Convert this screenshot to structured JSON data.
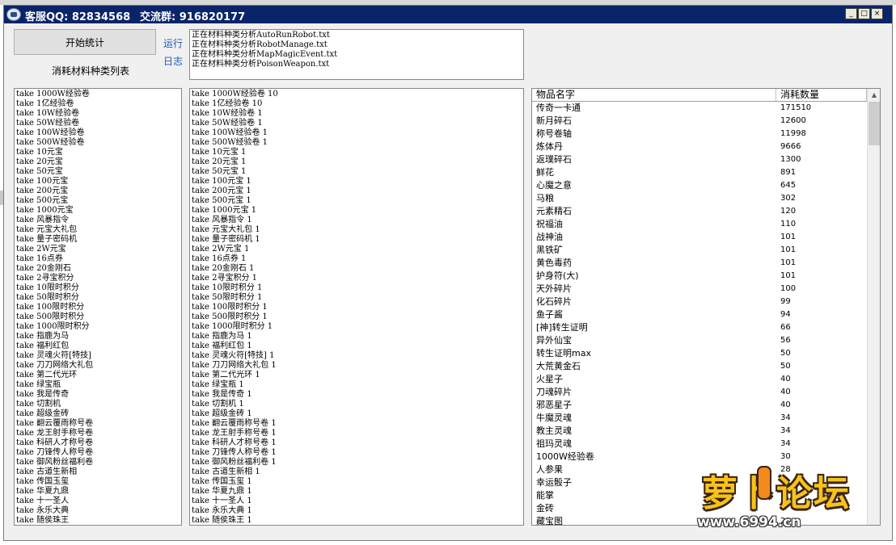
{
  "window": {
    "title_qq": "客服QQ: 82834568",
    "title_group": "交流群: 916820177",
    "minimize_glyph": "_",
    "maximize_glyph": "□",
    "close_glyph": "×"
  },
  "controls": {
    "start_button": "开始统计",
    "list_caption": "消耗材料种类列表",
    "run_link": "运行",
    "log_link": "日志"
  },
  "log_lines": [
    "正在材料种类分析AutoRunRobot.txt",
    "正在材料种类分析RobotManage.txt",
    "正在材料种类分析MapMagicEvent.txt",
    "正在材料种类分析PoisonWeapon.txt"
  ],
  "left_list": [
    "take 1000W经验卷",
    "take 1亿经验卷",
    "take 10W经验卷",
    "take 50W经验卷",
    "take 100W经验卷",
    "take 500W经验卷",
    "take 10元宝",
    "take 20元宝",
    "take 50元宝",
    "take 100元宝",
    "take 200元宝",
    "take 500元宝",
    "take 1000元宝",
    "take 风暴指令",
    "take 元宝大礼包",
    "take 量子密码机",
    "take 2W元宝",
    "take 16点券",
    "take 20金刚石",
    "take 2寻宝积分",
    "take 10限时积分",
    "take 50限时积分",
    "take 100限时积分",
    "take 500限时积分",
    "take 1000限时积分",
    "take 指鹿为马",
    "take 福利红包",
    "take 灵魂火符[特技]",
    "take 刀刀网络大礼包",
    "take 第二代光环",
    "take 绿宝瓶",
    "take 我是传奇",
    "take 切割机",
    "take 超级金砖",
    "take 翻云覆雨称号卷",
    "take 龙王射手称号卷",
    "take 科研人才称号卷",
    "take 刀锋传人称号卷",
    "take 御风粉丝福利卷",
    "take 古道生新相",
    "take 传国玉玺",
    "take 华夏九鼎",
    "take 十一圣人",
    "take 永乐大典",
    "take 随侯珠王"
  ],
  "mid_list": [
    "take 1000W经验卷 10",
    "take 1亿经验卷 10",
    "take 10W经验卷 1",
    "take 50W经验卷 1",
    "take 100W经验卷 1",
    "take 500W经验卷 1",
    "take 10元宝 1",
    "take 20元宝 1",
    "take 50元宝 1",
    "take 100元宝 1",
    "take 200元宝 1",
    "take 500元宝 1",
    "take 1000元宝 1",
    "take 风暴指令 1",
    "take 元宝大礼包 1",
    "take 量子密码机 1",
    "take 2W元宝 1",
    "take 16点券 1",
    "take 20金刚石 1",
    "take 2寻宝积分 1",
    "take 10限时积分 1",
    "take 50限时积分 1",
    "take 100限时积分 1",
    "take 500限时积分 1",
    "take 1000限时积分 1",
    "take 指鹿为马 1",
    "take 福利红包 1",
    "take 灵魂火符[特技] 1",
    "take 刀刀网络大礼包 1",
    "take 第二代光环 1",
    "take 绿宝瓶 1",
    "take 我是传奇 1",
    "take 切割机 1",
    "take 超级金砖 1",
    "take 翻云覆雨称号卷 1",
    "take 龙王射手称号卷 1",
    "take 科研人才称号卷 1",
    "take 刀锋传人称号卷 1",
    "take 御风粉丝福利卷 1",
    "take 古道生新相 1",
    "take 传国玉玺 1",
    "take 华夏九鼎 1",
    "take 十一圣人 1",
    "take 永乐大典 1",
    "take 随侯珠王 1"
  ],
  "table": {
    "columns": [
      "物品名字",
      "消耗数量"
    ],
    "rows": [
      {
        "name": "传奇一卡通",
        "qty": "171510"
      },
      {
        "name": "新月碎石",
        "qty": "12600"
      },
      {
        "name": "称号卷轴",
        "qty": "11998"
      },
      {
        "name": "炼体丹",
        "qty": "9666"
      },
      {
        "name": "返璞碎石",
        "qty": "1300"
      },
      {
        "name": "鲜花",
        "qty": "891"
      },
      {
        "name": "心魔之意",
        "qty": "645"
      },
      {
        "name": "马粮",
        "qty": "302"
      },
      {
        "name": "元素精石",
        "qty": "120"
      },
      {
        "name": "祝福油",
        "qty": "110"
      },
      {
        "name": "战神油",
        "qty": "101"
      },
      {
        "name": "黑铁矿",
        "qty": "101"
      },
      {
        "name": "黄色毒药",
        "qty": "101"
      },
      {
        "name": "护身符(大)",
        "qty": "101"
      },
      {
        "name": "天外碎片",
        "qty": "100"
      },
      {
        "name": "化石碎片",
        "qty": "99"
      },
      {
        "name": "鱼子酱",
        "qty": "94"
      },
      {
        "name": "[神]转生证明",
        "qty": "66"
      },
      {
        "name": "异外仙宝",
        "qty": "56"
      },
      {
        "name": "转生证明max",
        "qty": "50"
      },
      {
        "name": "大荒黄金石",
        "qty": "50"
      },
      {
        "name": "火星子",
        "qty": "40"
      },
      {
        "name": "刀魂碎片",
        "qty": "40"
      },
      {
        "name": "邪恶星子",
        "qty": "40"
      },
      {
        "name": "牛魔灵魂",
        "qty": "34"
      },
      {
        "name": "教主灵魂",
        "qty": "34"
      },
      {
        "name": "祖玛灵魂",
        "qty": "34"
      },
      {
        "name": "1000W经验卷",
        "qty": "30"
      },
      {
        "name": "人参果",
        "qty": "28"
      },
      {
        "name": "幸运骰子",
        "qty": ""
      },
      {
        "name": "能掌",
        "qty": ""
      },
      {
        "name": "金砖",
        "qty": ""
      },
      {
        "name": "藏宝图",
        "qty": "20"
      }
    ]
  },
  "watermark": {
    "main": "萝卜论坛",
    "url": "www.6994.cn"
  }
}
